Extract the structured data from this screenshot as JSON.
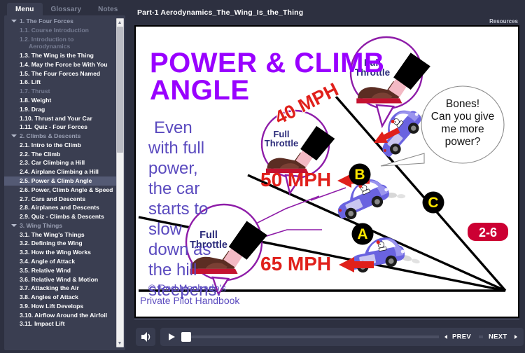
{
  "sidebar": {
    "tabs": [
      {
        "label": "Menu",
        "active": true
      },
      {
        "label": "Glossary",
        "active": false
      },
      {
        "label": "Notes",
        "active": false
      }
    ],
    "items": [
      {
        "label": "1. The Four Forces",
        "type": "group",
        "state": "dim"
      },
      {
        "label": "1.1. Course Introduction",
        "type": "leaf",
        "state": "dim"
      },
      {
        "label": "1.2. Introduction to Aerodynamics",
        "type": "leaf",
        "state": "dim"
      },
      {
        "label": "1.3. The Wing is the Thing",
        "type": "leaf",
        "state": "normal"
      },
      {
        "label": "1.4. May the Force be With You",
        "type": "leaf",
        "state": "normal"
      },
      {
        "label": "1.5. The Four Forces Named",
        "type": "leaf",
        "state": "normal"
      },
      {
        "label": "1.6. Lift",
        "type": "leaf",
        "state": "normal"
      },
      {
        "label": "1.7. Thrust",
        "type": "leaf",
        "state": "dim"
      },
      {
        "label": "1.8. Weight",
        "type": "leaf",
        "state": "normal"
      },
      {
        "label": "1.9. Drag",
        "type": "leaf",
        "state": "normal"
      },
      {
        "label": "1.10. Thrust and Your Car",
        "type": "leaf",
        "state": "normal"
      },
      {
        "label": "1.11. Quiz - Four Forces",
        "type": "leaf",
        "state": "normal"
      },
      {
        "label": "2. Climbs & Descents",
        "type": "group",
        "state": "dim"
      },
      {
        "label": "2.1. Intro to the Climb",
        "type": "leaf",
        "state": "normal"
      },
      {
        "label": "2.2. The Climb",
        "type": "leaf",
        "state": "normal"
      },
      {
        "label": "2.3. Car Climbing a Hill",
        "type": "leaf",
        "state": "normal"
      },
      {
        "label": "2.4. Airplane Climbing a Hill",
        "type": "leaf",
        "state": "normal"
      },
      {
        "label": "2.5. Power & Climb Angle",
        "type": "leaf",
        "state": "selected"
      },
      {
        "label": "2.6. Power, Climb Angle & Speed",
        "type": "leaf",
        "state": "normal"
      },
      {
        "label": "2.7. Cars and Descents",
        "type": "leaf",
        "state": "normal"
      },
      {
        "label": "2.8. Airplanes and Descents",
        "type": "leaf",
        "state": "normal"
      },
      {
        "label": "2.9. Quiz - Climbs & Descents",
        "type": "leaf",
        "state": "normal"
      },
      {
        "label": "3. Wing Things",
        "type": "group",
        "state": "dim"
      },
      {
        "label": "3.1. The Wing's Things",
        "type": "leaf",
        "state": "normal"
      },
      {
        "label": "3.2. Defining the Wing",
        "type": "leaf",
        "state": "normal"
      },
      {
        "label": "3.3. How the Wing Works",
        "type": "leaf",
        "state": "normal"
      },
      {
        "label": "3.4. Angle of Attack",
        "type": "leaf",
        "state": "normal"
      },
      {
        "label": "3.5. Relative Wind",
        "type": "leaf",
        "state": "normal"
      },
      {
        "label": "3.6. Relative Wind & Motion",
        "type": "leaf",
        "state": "normal"
      },
      {
        "label": "3.7. Attacking the Air",
        "type": "leaf",
        "state": "normal"
      },
      {
        "label": "3.8. Angles of Attack",
        "type": "leaf",
        "state": "normal"
      },
      {
        "label": "3.9. How Lift Develops",
        "type": "leaf",
        "state": "normal"
      },
      {
        "label": "3.10. Airflow Around the Airfoil",
        "type": "leaf",
        "state": "normal"
      },
      {
        "label": "3.11. Impact Lift",
        "type": "leaf",
        "state": "normal"
      }
    ]
  },
  "header": {
    "title": "Part-1 Aerodynamics_The_Wing_Is_the_Thing",
    "resources_label": "Resources"
  },
  "slide": {
    "title_line1": "POWER & CLIMB",
    "title_line2": "ANGLE",
    "body_lines": [
      "Even",
      "with full",
      "power,",
      "the car",
      "starts to",
      "slow",
      "down as",
      "the hill",
      "steepens."
    ],
    "copyright_line1": "© Rod Machado's",
    "copyright_line2": "Private Pilot Handbook",
    "throttle_label_line1": "Full",
    "throttle_label_line2": "Throttle",
    "speech_lines": [
      "Bones!",
      "Can you give",
      "me more",
      "power?"
    ],
    "speeds": [
      {
        "value": "40 MPH",
        "marker": "C"
      },
      {
        "value": "50 MPH",
        "marker": "B"
      },
      {
        "value": "65 MPH",
        "marker": "A"
      }
    ],
    "markers": [
      "A",
      "B",
      "C"
    ],
    "page_badge": "2-6",
    "colors": {
      "title_purple": "#9900ff",
      "body_purple": "#5b4bbf",
      "speed_red": "#e0201b",
      "marker_yellow": "#ffe600",
      "badge_red": "#cc0033",
      "circle_purple": "#8e1ca8",
      "car_blue": "#6a63e0"
    }
  },
  "player": {
    "volume_icon": "speaker-icon",
    "play_icon": "play-icon",
    "replay_icon": "replay-icon",
    "prev_label": "PREV",
    "next_label": "NEXT"
  }
}
